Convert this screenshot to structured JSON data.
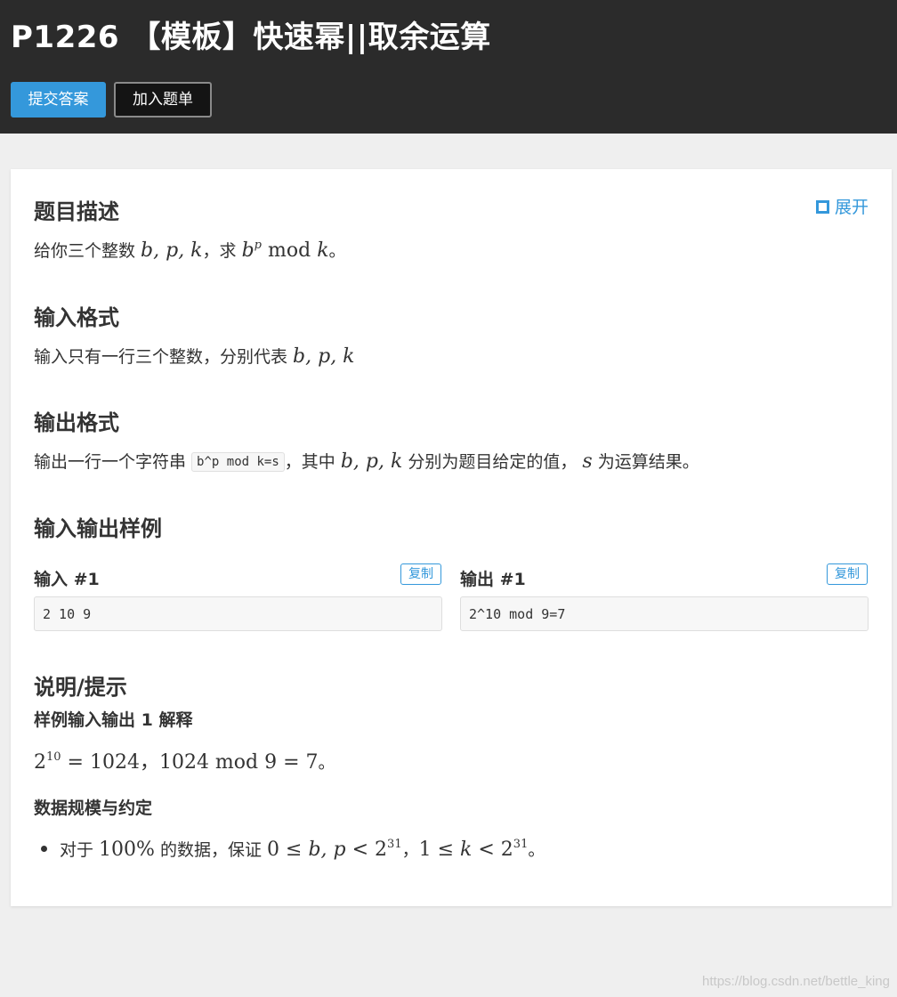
{
  "header": {
    "title": "P1226 【模板】快速幂||取余运算",
    "submit_label": "提交答案",
    "add_label": "加入题单"
  },
  "problem": {
    "expand_label": "展开",
    "desc_heading": "题目描述",
    "desc_text1": "给你三个整数 ",
    "desc_vars": "b, p, k",
    "desc_text2": "，求 ",
    "desc_base": "b",
    "desc_exp": "p",
    "desc_mod": " mod ",
    "desc_k": "k",
    "desc_end": "。",
    "input_heading": "输入格式",
    "input_text": "输入只有一行三个整数，分别代表 ",
    "input_vars": "b, p, k",
    "output_heading": "输出格式",
    "output_text1": "输出一行一个字符串 ",
    "output_code": "b^p mod k=s",
    "output_text2": "，其中 ",
    "output_vars": "b, p, k",
    "output_text3": " 分别为题目给定的值， ",
    "output_s": "s",
    "output_text4": " 为运算结果。",
    "samples_heading": "输入输出样例",
    "input_sample_label": "输入 #1",
    "output_sample_label": "输出 #1",
    "copy_label": "复制",
    "input_sample_value": "2 10 9",
    "output_sample_value": "2^10 mod 9=7",
    "hint_heading": "说明/提示",
    "hint_sub1": "样例输入输出 1 解释",
    "hint_eq_base": "2",
    "hint_eq_exp": "10",
    "hint_eq_rest": " = 1024，1024 mod 9 = 7",
    "hint_eq_end": "。",
    "hint_sub2": "数据规模与约定",
    "bullet_text1": "对于 ",
    "bullet_pct": "100%",
    "bullet_text2": " 的数据，保证 ",
    "bullet_c1a": "0 ≤ ",
    "bullet_c1v": "b, p",
    "bullet_c1b": " < 2",
    "bullet_exp1": "31",
    "bullet_sep": "，",
    "bullet_c2a": "1 ≤ ",
    "bullet_c2v": "k",
    "bullet_c2b": " < 2",
    "bullet_exp2": "31",
    "bullet_end": "。"
  },
  "watermark": "https://blog.csdn.net/bettle_king",
  "colors": {
    "header_bg": "#2b2b2b",
    "accent": "#3498db",
    "page_bg": "#efefef",
    "card_bg": "#ffffff"
  }
}
